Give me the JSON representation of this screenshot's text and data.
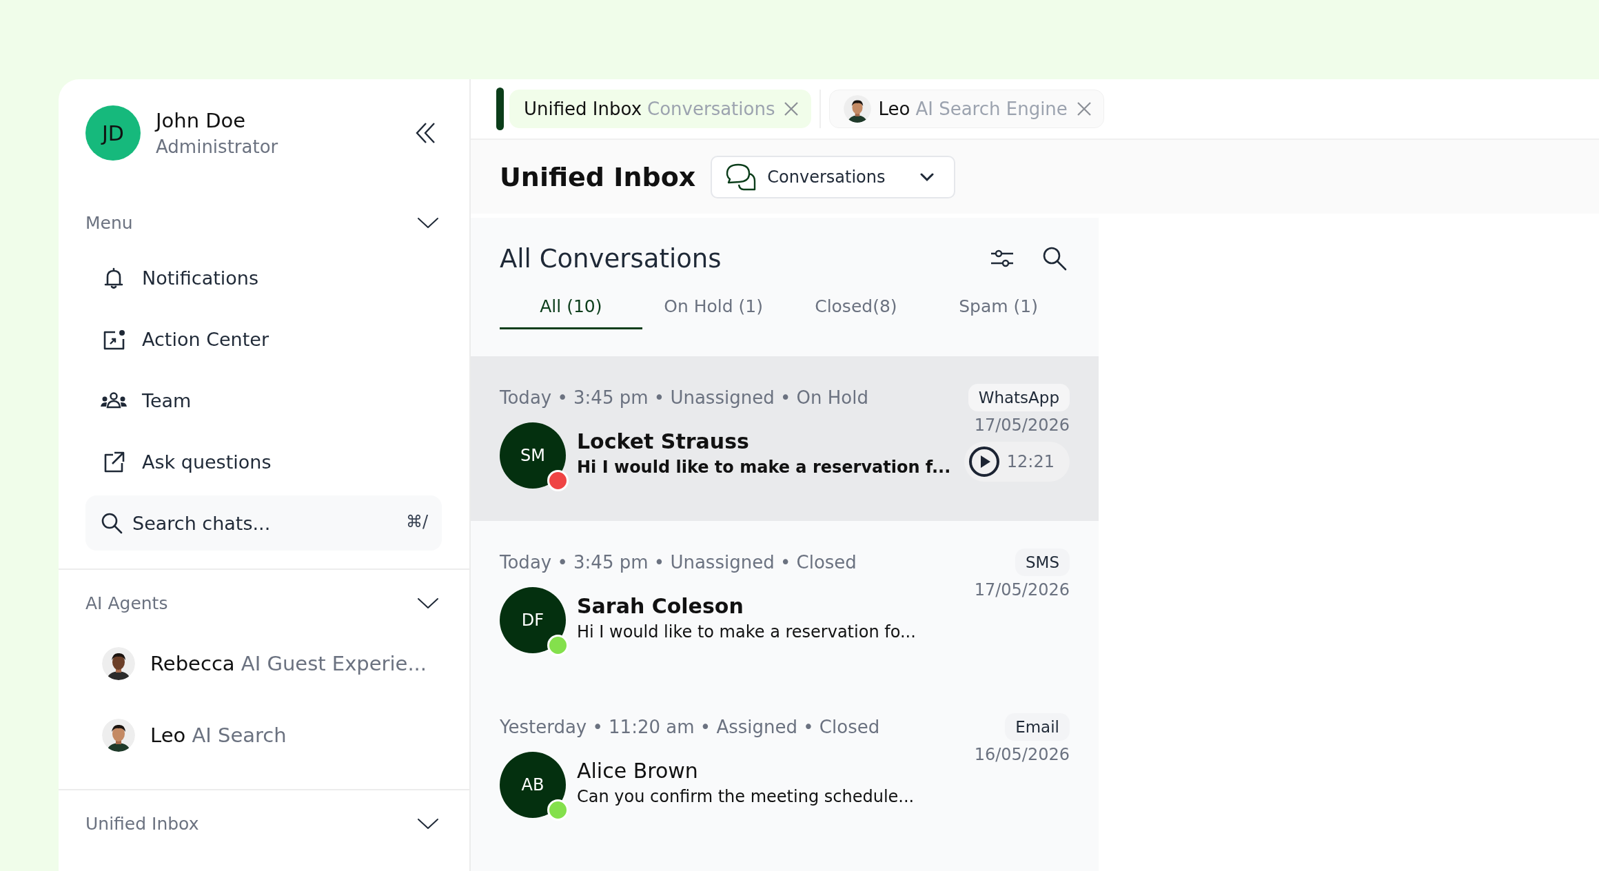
{
  "user": {
    "initials": "JD",
    "name": "John Doe",
    "role": "Administrator"
  },
  "sidebar": {
    "sections": [
      {
        "label": "Menu",
        "expanded": true,
        "items": [
          {
            "label": "Notifications"
          },
          {
            "label": "Action Center"
          },
          {
            "label": "Team"
          },
          {
            "label": "Ask questions"
          }
        ],
        "search": {
          "placeholder": "Search chats...",
          "shortcut": "⌘/"
        }
      },
      {
        "label": "AI Agents",
        "expanded": true,
        "agents": [
          {
            "name": "Rebecca",
            "role": "AI Guest Experie..."
          },
          {
            "name": "Leo",
            "role": "AI Search"
          }
        ]
      },
      {
        "label": "Unified Inbox",
        "expanded": true
      }
    ]
  },
  "tabs": [
    {
      "kind": "page",
      "title": "Unified Inbox",
      "subtitle": "Conversations",
      "selected": true
    },
    {
      "kind": "agent",
      "title": "Leo",
      "subtitle": "AI Search Engine",
      "selected": false
    }
  ],
  "header": {
    "title": "Unified Inbox",
    "view": "Conversations"
  },
  "list": {
    "title": "All Conversations",
    "filters": [
      {
        "label": "All (10)",
        "selected": true
      },
      {
        "label": "On Hold (1)",
        "selected": false
      },
      {
        "label": "Closed(8)",
        "selected": false
      },
      {
        "label": "Spam (1)",
        "selected": false
      }
    ],
    "conversations": [
      {
        "meta": "Today • 3:45 pm • Unassigned • On Hold",
        "channel": "WhatsApp",
        "initials": "SM",
        "color": "#ef4444",
        "name": "Locket Strauss",
        "preview": "Hi I would like to make a reservation f...",
        "date": "17/05/2026",
        "voice_note": "12:21",
        "selected": true,
        "name_bold": true,
        "preview_bold": true
      },
      {
        "meta": "Today • 3:45 pm • Unassigned • Closed",
        "channel": "SMS",
        "initials": "DF",
        "color": "#84e04c",
        "name": "Sarah Coleson",
        "preview": "Hi I would like to make a reservation fo...",
        "date": "17/05/2026",
        "selected": false,
        "name_bold": true,
        "preview_bold": false
      },
      {
        "meta": "Yesterday • 11:20 am • Assigned • Closed",
        "channel": "Email",
        "initials": "AB",
        "color": "#84e04c",
        "name": "Alice Brown",
        "preview": "Can you confirm the meeting schedule...",
        "date": "16/05/2026",
        "selected": false,
        "name_bold": false,
        "preview_bold": false
      }
    ]
  }
}
